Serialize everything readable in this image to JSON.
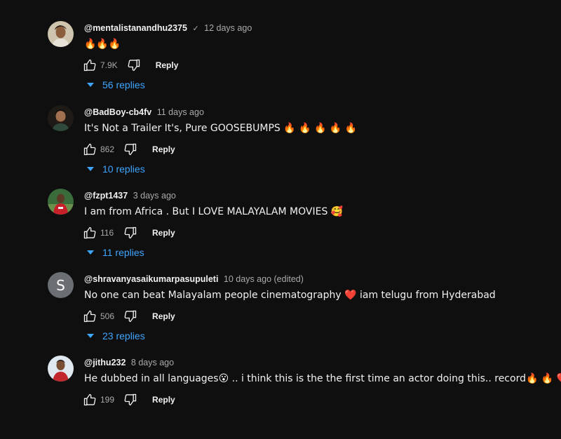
{
  "comments": [
    {
      "handle": "@mentalistanandhu2375",
      "verified": true,
      "time": "12 days ago",
      "text": "🔥🔥🔥",
      "likes": "7.9K",
      "reply_label": "Reply",
      "replies": "56 replies",
      "avatar_type": "photo",
      "avatar_color": "#c8b99a"
    },
    {
      "handle": "@BadBoy-cb4fv",
      "verified": false,
      "time": "11 days ago",
      "text": "It's Not a Trailer It's, Pure GOOSEBUMPS 🔥 🔥 🔥 🔥 🔥",
      "likes": "862",
      "reply_label": "Reply",
      "replies": "10 replies",
      "avatar_type": "photo",
      "avatar_color": "#3a3128"
    },
    {
      "handle": "@fzpt1437",
      "verified": false,
      "time": "3 days ago",
      "text": "I am from Africa . But I LOVE MALAYALAM MOVIES 🥰",
      "likes": "116",
      "reply_label": "Reply",
      "replies": "11 replies",
      "avatar_type": "photo",
      "avatar_color": "#b01f24"
    },
    {
      "handle": "@shravanyasaikumarpasupuleti",
      "verified": false,
      "time": "10 days ago (edited)",
      "text": "No one can beat Malayalam people cinematography ❤️ iam telugu from Hyderabad",
      "likes": "506",
      "reply_label": "Reply",
      "replies": "23 replies",
      "avatar_type": "letter",
      "avatar_letter": "S",
      "avatar_color": "#6b6f73"
    },
    {
      "handle": "@jithu232",
      "verified": false,
      "time": "8 days ago",
      "text": "He dubbed in all languages😮 .. i think this is the the first time an actor doing this.. record🔥 🔥 ❤️ ❤️",
      "likes": "199",
      "reply_label": "Reply",
      "replies": "",
      "avatar_type": "photo",
      "avatar_color": "#d8e4ec"
    }
  ],
  "icons": {
    "like": "thumbs-up-icon",
    "dislike": "thumbs-down-icon",
    "expand": "caret-down-icon",
    "verified": "checkmark-icon"
  },
  "colors": {
    "background": "#0f0f0f",
    "link": "#3ea6ff",
    "muted": "#aaaaaa"
  }
}
